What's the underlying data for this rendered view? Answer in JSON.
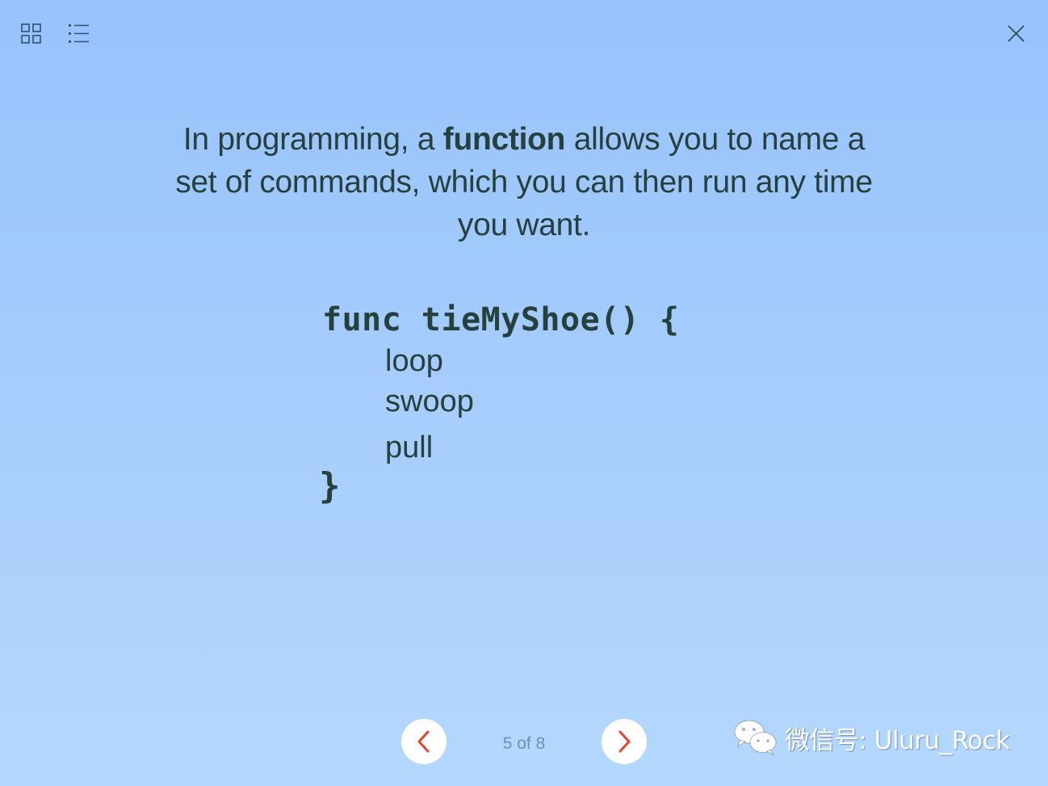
{
  "toolbar": {
    "grid_icon": "grid-icon",
    "list_icon": "list-icon",
    "close_icon": "close-icon"
  },
  "intro": {
    "before": "In programming, a ",
    "bold": "function",
    "after": " allows you to name a set of commands, which you can then run any time you want."
  },
  "code": {
    "signature": "func tieMyShoe() {",
    "lines": [
      "loop",
      "swoop",
      "pull"
    ],
    "closing": "}"
  },
  "navigation": {
    "prev_icon": "chevron-left-icon",
    "next_icon": "chevron-right-icon",
    "page_indicator": "5 of 8",
    "current_page": 5,
    "total_pages": 8,
    "accent_color": "#e8432c"
  },
  "watermark": {
    "icon": "wechat-icon",
    "text": "微信号: Uluru_Rock"
  }
}
